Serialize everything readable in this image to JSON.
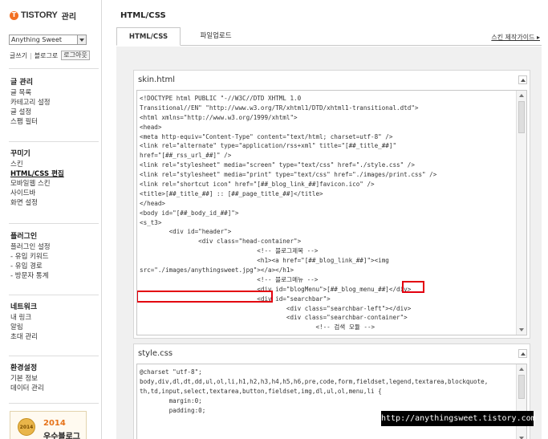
{
  "app": {
    "logo_mark": "T",
    "logo_text": "TISTORY",
    "logo_sub": "관리"
  },
  "sidebar": {
    "blog_select": "Anything Sweet",
    "quick_write": "글쓰기",
    "quick_blog": "블로그로",
    "logout": "로그아웃",
    "groups": [
      {
        "title": "글 관리",
        "items": [
          "글 목록",
          "카테고리 설정",
          "글 설정",
          "스팸 필터"
        ]
      },
      {
        "title": "꾸미기",
        "items": [
          "스킨",
          "HTML/CSS 편집",
          "모바일웹 스킨",
          "사이드바",
          "화면 설정"
        ]
      },
      {
        "title": "플러그인",
        "items": [
          "플러그인 설정",
          "- 유입 키워드",
          "- 유입 경로",
          "- 방문자 통계"
        ]
      },
      {
        "title": "네트워크",
        "items": [
          "내 링크",
          "알림",
          "초대 관리"
        ]
      },
      {
        "title": "환경설정",
        "items": [
          "기본 정보",
          "데이터 관리"
        ]
      }
    ],
    "award": {
      "medal_text": "2014",
      "year": "2014",
      "name": "우수블로그"
    }
  },
  "main": {
    "page_title": "HTML/CSS",
    "tabs": [
      {
        "label": "HTML/CSS",
        "active": true
      },
      {
        "label": "파일업로드",
        "active": false
      }
    ],
    "guide_link": "스킨 제작가이드 ▸"
  },
  "skin_html": {
    "title": "skin.html",
    "lines": [
      "<!DOCTYPE html PUBLIC \"-//W3C//DTD XHTML 1.0",
      "Transitional//EN\" \"http://www.w3.org/TR/xhtml1/DTD/xhtml1-transitional.dtd\">",
      "<html xmlns=\"http://www.w3.org/1999/xhtml\">",
      "<head>",
      "<meta http-equiv=\"Content-Type\" content=\"text/html; charset=utf-8\" />",
      "<link rel=\"alternate\" type=\"application/rss+xml\" title=\"[##_title_##]\"",
      "href=\"[##_rss_url_##]\" />",
      "<link rel=\"stylesheet\" media=\"screen\" type=\"text/css\" href=\"./style.css\" />",
      "<link rel=\"stylesheet\" media=\"print\" type=\"text/css\" href=\"./images/print.css\" />",
      "<link rel=\"shortcut icon\" href=\"[##_blog_link_##]favicon.ico\" />",
      "<title>[##_title_##] :: [##_page_title_##]</title>",
      "</head>",
      "<body id=\"[##_body_id_##]\">",
      "<s_t3>",
      "        <div id=\"header\">",
      "                <div class=\"head-container\">",
      "                                <!-- 블로그제목 -->",
      "                                <h1><a href=\"[##_blog_link_##]\"><img",
      "src=\"./images/anythingsweet.jpg\"></a></h1>",
      "                                <!-- 블로그메뉴 -->",
      "                                <div id=\"blogMenu\">[##_blog_menu_##]</div>",
      "                                <div id=\"searchbar\">",
      "                                        <div class=\"searchbar-left\"></div>",
      "                                        <div class=\"searchbar-container\">",
      "                                                <!-- 검색 모듈 -->"
    ]
  },
  "style_css": {
    "title": "style.css",
    "lines": [
      "@charset \"utf-8\";",
      "body,div,dl,dt,dd,ul,ol,li,h1,h2,h3,h4,h5,h6,pre,code,form,fieldset,legend,textarea,blockquote,",
      "th,td,input,select,textarea,button,fieldset,img,dl,ul,ol,menu,li {",
      "        margin:0;",
      "        padding:0;"
    ]
  },
  "watermark": "http://anythingsweet.tistory.com"
}
